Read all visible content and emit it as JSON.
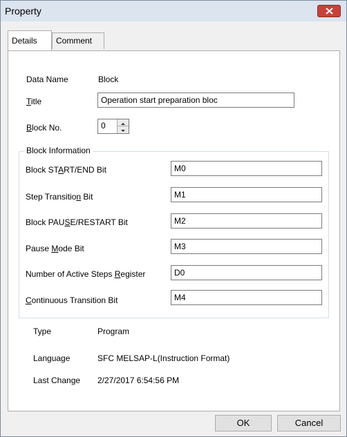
{
  "window": {
    "title": "Property"
  },
  "tabs": [
    {
      "label": "Details"
    },
    {
      "label": "Comment"
    }
  ],
  "details": {
    "data_name_label": "Data Name",
    "data_name_value": "Block",
    "title_label": "Title",
    "title_value": "Operation start preparation bloc",
    "block_no_label": "Block No.",
    "block_no_value": "0"
  },
  "block_information": {
    "group_label": "Block Information",
    "rows": [
      {
        "label": "Block START/END Bit",
        "value": "M0"
      },
      {
        "label": "Step Transition Bit",
        "value": "M1"
      },
      {
        "label": "Block PAUSE/RESTART Bit",
        "value": "M2"
      },
      {
        "label": "Pause Mode Bit",
        "value": "M3"
      },
      {
        "label": "Number of Active Steps Register",
        "value": "D0"
      },
      {
        "label": "Continuous Transition Bit",
        "value": "M4"
      }
    ]
  },
  "info": {
    "type_label": "Type",
    "type_value": "Program",
    "language_label": "Language",
    "language_value": "SFC MELSAP-L(Instruction Format)",
    "last_change_label": "Last Change",
    "last_change_value": "2/27/2017 6:54:56 PM"
  },
  "buttons": {
    "ok": "OK",
    "cancel": "Cancel"
  },
  "colors": {
    "close_button": "#c7423a",
    "titlebar": "#dbe4ef"
  },
  "icons": {
    "close": "close-icon",
    "spin_up": "spin-up-icon",
    "spin_down": "spin-down-icon"
  }
}
